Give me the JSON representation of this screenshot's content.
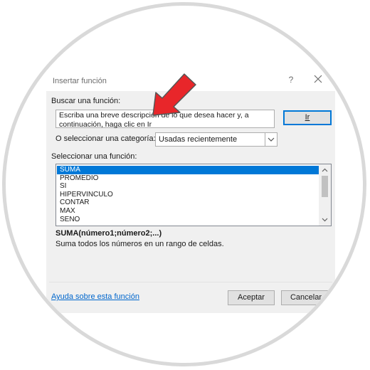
{
  "dialog": {
    "title": "Insertar función",
    "help_glyph": "?",
    "search_label": "Buscar una función:",
    "search_text": "Escriba una breve descripción de lo que desea hacer y, a continuación, haga clic en Ir",
    "go_label": "Ir",
    "category_label": "O seleccionar una categoría:",
    "category_value": "Usadas recientemente",
    "function_label": "Seleccionar una función:",
    "functions": [
      "SUMA",
      "PROMEDIO",
      "SI",
      "HIPERVINCULO",
      "CONTAR",
      "MAX",
      "SENO"
    ],
    "selected_index": 0,
    "syntax": "SUMA(número1;número2;...)",
    "description": "Suma todos los números en un rango de celdas.",
    "help_link": "Ayuda sobre esta función",
    "ok_label": "Aceptar",
    "cancel_label": "Cancelar"
  },
  "icons": {
    "annotation_arrow": "red-arrow-icon",
    "close": "close-icon",
    "dropdown": "chevron-down-icon"
  },
  "colors": {
    "accent": "#0078d7",
    "arrow": "#e8262a",
    "link": "#0066cc"
  }
}
